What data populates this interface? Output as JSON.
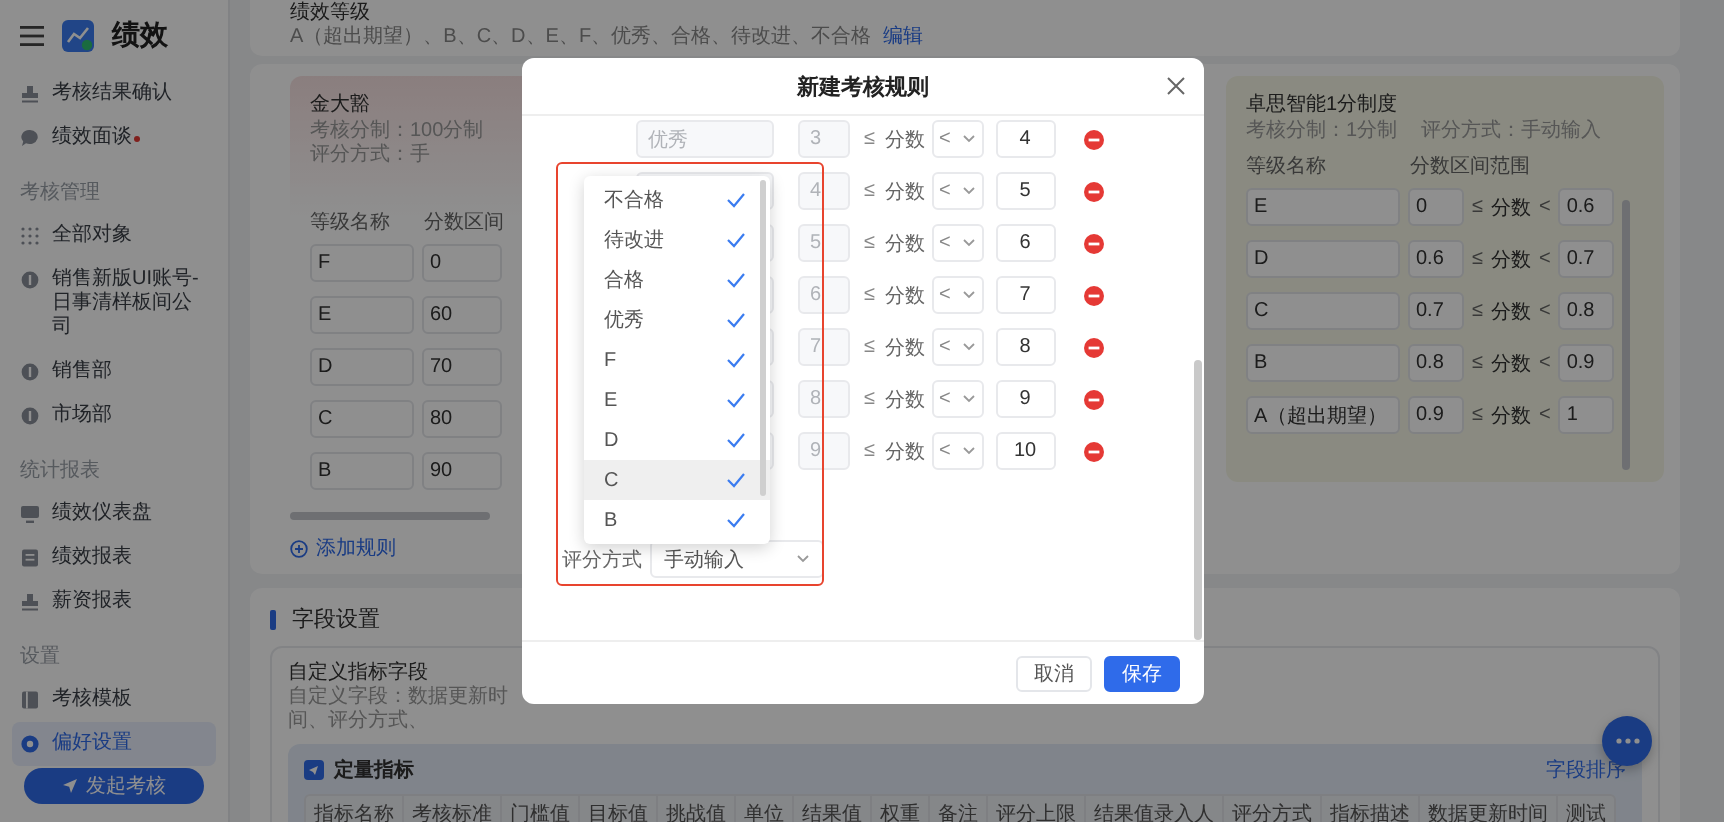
{
  "app": {
    "title": "绩效"
  },
  "sidebar": {
    "groups": [
      {
        "items": [
          {
            "label": "考核结果确认",
            "selected": false,
            "dot": false
          },
          {
            "label": "绩效面谈",
            "selected": false,
            "dot": true
          }
        ]
      },
      {
        "heading": "考核管理",
        "items": [
          {
            "label": "全部对象",
            "selected": false,
            "dot": false
          },
          {
            "label": "销售新版UI账号-日事清样板间公司",
            "selected": false,
            "dot": false
          },
          {
            "label": "销售部",
            "selected": false,
            "dot": false
          },
          {
            "label": "市场部",
            "selected": false,
            "dot": false
          }
        ]
      },
      {
        "heading": "统计报表",
        "items": [
          {
            "label": "绩效仪表盘",
            "selected": false,
            "dot": false
          },
          {
            "label": "绩效报表",
            "selected": false,
            "dot": false
          },
          {
            "label": "薪资报表",
            "selected": false,
            "dot": false
          }
        ]
      },
      {
        "heading": "设置",
        "items": [
          {
            "label": "考核模板",
            "selected": false,
            "dot": false
          },
          {
            "label": "偏好设置",
            "selected": true,
            "dot": false
          }
        ]
      }
    ],
    "action_button": "发起考核"
  },
  "grade_levels": {
    "title": "绩效等级",
    "list": "A（超出期望）、B、C、D、E、F、优秀、合格、待改进、不合格",
    "edit_link": "编辑"
  },
  "rule_cards": [
    {
      "title": "金大豁",
      "scale": "考核分制：100分制",
      "method": "评分方式：手",
      "columns": [
        "等级名称",
        "分数区间"
      ],
      "rows": [
        {
          "grade": "F",
          "from": "0"
        },
        {
          "grade": "E",
          "from": "60"
        },
        {
          "grade": "D",
          "from": "70"
        },
        {
          "grade": "C",
          "from": "80"
        },
        {
          "grade": "B",
          "from": "90"
        }
      ]
    },
    {
      "title": "卓思智能1分制度",
      "scale": "考核分制：1分制",
      "method": "评分方式：手动输入",
      "columns": [
        "等级名称",
        "分数区间范围"
      ],
      "rows": [
        {
          "grade": "E",
          "from": "0",
          "lower_op": "≤",
          "variable": "分数",
          "upper_op": "<",
          "to": "0.6"
        },
        {
          "grade": "D",
          "from": "0.6",
          "lower_op": "≤",
          "variable": "分数",
          "upper_op": "<",
          "to": "0.7"
        },
        {
          "grade": "C",
          "from": "0.7",
          "lower_op": "≤",
          "variable": "分数",
          "upper_op": "<",
          "to": "0.8"
        },
        {
          "grade": "B",
          "from": "0.8",
          "lower_op": "≤",
          "variable": "分数",
          "upper_op": "<",
          "to": "0.9"
        },
        {
          "grade": "A（超出期望）",
          "from": "0.9",
          "lower_op": "≤",
          "variable": "分数",
          "upper_op": "<",
          "to": "1"
        }
      ]
    }
  ],
  "add_rule": "添加规则",
  "field_settings": {
    "title": "字段设置",
    "subtitle": "自定义指标字段",
    "hint": "自定义字段：数据更新时间、评分方式、",
    "group": {
      "title": "定量指标",
      "sort_link": "字段排序",
      "fields": [
        "指标名称",
        "考核标准",
        "门槛值",
        "目标值",
        "挑战值",
        "单位",
        "结果值",
        "权重",
        "备注",
        "评分上限",
        "结果值录入人",
        "评分方式",
        "指标描述",
        "数据更新时间",
        "测试"
      ]
    }
  },
  "modal": {
    "title": "新建考核规则",
    "rows": [
      {
        "grade": "优秀",
        "from": "3",
        "lower_op": "≤",
        "variable": "分数",
        "upper_op": "<",
        "to": "4"
      },
      {
        "from": "4",
        "lower_op": "≤",
        "variable": "分数",
        "upper_op": "<",
        "to": "5"
      },
      {
        "from": "5",
        "lower_op": "≤",
        "variable": "分数",
        "upper_op": "<",
        "to": "6"
      },
      {
        "from": "6",
        "lower_op": "≤",
        "variable": "分数",
        "upper_op": "<",
        "to": "7"
      },
      {
        "from": "7",
        "lower_op": "≤",
        "variable": "分数",
        "upper_op": "<",
        "to": "8"
      },
      {
        "from": "8",
        "lower_op": "≤",
        "variable": "分数",
        "upper_op": "<",
        "to": "9"
      },
      {
        "from": "9",
        "lower_op": "≤",
        "variable": "分数",
        "upper_op": "<",
        "to": "10"
      }
    ],
    "method": {
      "label": "评分方式",
      "value": "手动输入"
    },
    "buttons": [
      {
        "label": "取消",
        "kind": "secondary"
      },
      {
        "label": "保存",
        "kind": "primary"
      }
    ]
  },
  "dropdown": {
    "options": [
      {
        "label": "不合格",
        "checked": true,
        "selected": false
      },
      {
        "label": "待改进",
        "checked": true,
        "selected": false
      },
      {
        "label": "合格",
        "checked": true,
        "selected": false
      },
      {
        "label": "优秀",
        "checked": true,
        "selected": false
      },
      {
        "label": "F",
        "checked": true,
        "selected": false
      },
      {
        "label": "E",
        "checked": true,
        "selected": false
      },
      {
        "label": "D",
        "checked": true,
        "selected": false
      },
      {
        "label": "C",
        "checked": true,
        "selected": true
      },
      {
        "label": "B",
        "checked": true,
        "selected": false
      }
    ]
  }
}
